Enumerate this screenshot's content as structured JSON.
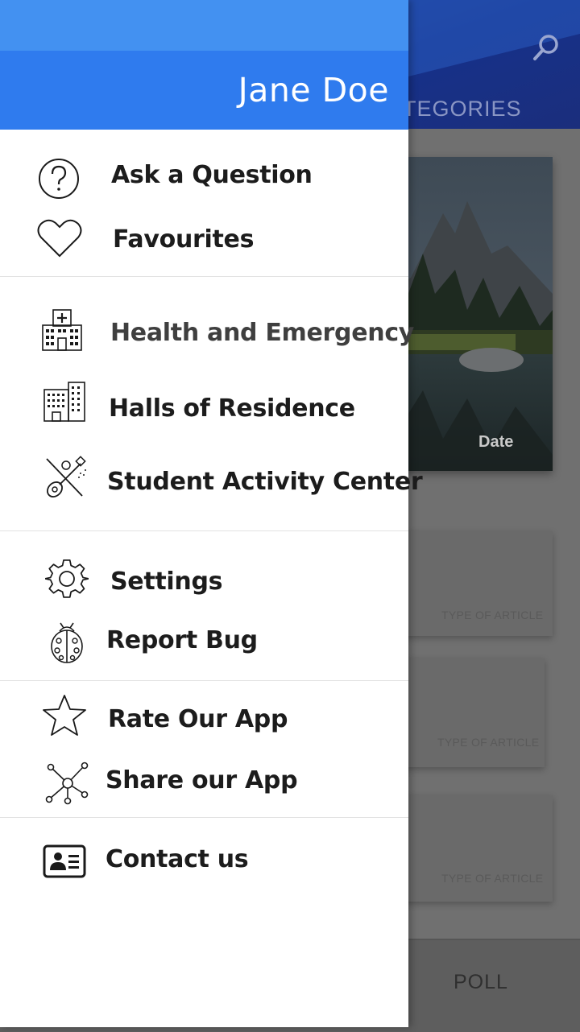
{
  "background": {
    "tab_categories": "TEGORIES",
    "hero_date": "Date",
    "articles": [
      {
        "type": "TYPE OF ARTICLE"
      },
      {
        "type": "TYPE OF ARTICLE"
      },
      {
        "type": "TYPE OF ARTICLE"
      }
    ],
    "bottom_nav": {
      "poll": "POLL"
    },
    "icons": {
      "search": "search-icon"
    }
  },
  "drawer": {
    "header": {
      "user_name": "Jane Doe"
    },
    "sections": [
      [
        {
          "label": "Ask a Question",
          "icon": "question-icon"
        },
        {
          "label": "Favourites",
          "icon": "heart-icon"
        }
      ],
      [
        {
          "label": "Health and Emergency",
          "icon": "hospital-icon"
        },
        {
          "label": "Halls of Residence",
          "icon": "building-icon"
        },
        {
          "label": "Student Activity Center",
          "icon": "guitar-icon"
        }
      ],
      [
        {
          "label": "Settings",
          "icon": "gear-icon"
        },
        {
          "label": "Report Bug",
          "icon": "bug-icon"
        }
      ],
      [
        {
          "label": "Rate Our App",
          "icon": "star-icon"
        },
        {
          "label": "Share our App",
          "icon": "share-icon"
        }
      ],
      [
        {
          "label": "Contact us",
          "icon": "contact-card-icon"
        }
      ]
    ]
  },
  "colors": {
    "drawer_header": "#2f7bee",
    "drawer_status": "#4391f1",
    "app_bar": "#1f4fa8",
    "scrim_gray": "#707070"
  }
}
